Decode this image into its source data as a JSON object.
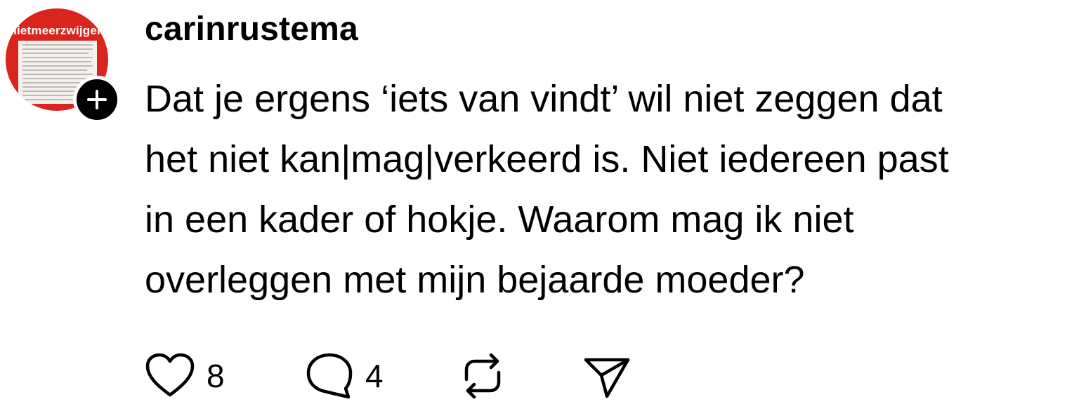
{
  "post": {
    "avatar": {
      "banner_text": "nietmeerzwijgen",
      "follow_icon": "plus-icon"
    },
    "username": "carinrustema",
    "text_lines": [
      "Dat je ergens ‘iets van vindt’ wil niet zeggen dat",
      "het niet kan|mag|verkeerd is. Niet iedereen past",
      "in een kader of hokje. Waarom mag ik niet",
      "overleggen met mijn bejaarde moeder?"
    ],
    "actions": {
      "like": {
        "icon": "heart-icon",
        "count": "8"
      },
      "reply": {
        "icon": "speech-bubble-icon",
        "count": "4"
      },
      "repost": {
        "icon": "repost-icon"
      },
      "share": {
        "icon": "paper-plane-icon"
      }
    },
    "colors": {
      "avatar_red": "#d9251d",
      "text": "#000000",
      "background": "#ffffff"
    }
  }
}
